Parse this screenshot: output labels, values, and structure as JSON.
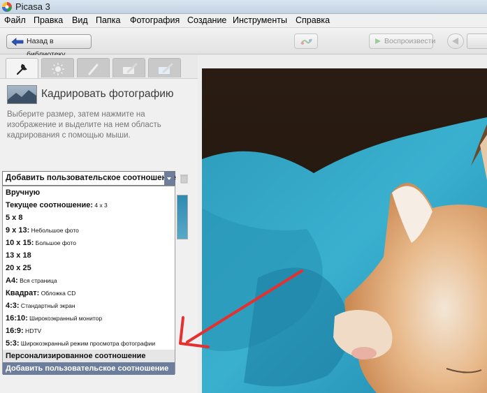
{
  "window": {
    "title": "Picasa 3"
  },
  "menu": [
    "Файл",
    "Правка",
    "Вид",
    "Папка",
    "Фотография",
    "Создание",
    "Инструменты",
    "Справка"
  ],
  "toolbar": {
    "back_label": "Назад в библиотеку",
    "play_label": "Воспроизвести"
  },
  "panel": {
    "title": "Кадрировать фотографию",
    "description": "Выберите размер, затем нажмите на изображение и выделите на нем область кадрирования с помощью мыши.",
    "selected_ratio": "Добавить пользовательское соотношение"
  },
  "ratio_options": [
    {
      "bold": "Вручную",
      "note": ""
    },
    {
      "bold": "Текущее соотношение:",
      "note": " 4 x 3"
    },
    {
      "bold": "5 x 8",
      "note": ""
    },
    {
      "bold": "9 x 13:",
      "note": " Небольшое фото"
    },
    {
      "bold": "10 x 15:",
      "note": " Большое фото"
    },
    {
      "bold": "13 x 18",
      "note": ""
    },
    {
      "bold": "20 x 25",
      "note": ""
    },
    {
      "bold": "A4:",
      "note": " Вся страница"
    },
    {
      "bold": "Квадрат:",
      "note": " Обложка CD"
    },
    {
      "bold": "4:3:",
      "note": " Стандартный экран"
    },
    {
      "bold": "16:10:",
      "note": " Широкоэкранный монитор"
    },
    {
      "bold": "16:9:",
      "note": " HDTV"
    },
    {
      "bold": "5:3:",
      "note": " Широкоэкранный режим просмотра фотографии"
    },
    {
      "bold": "Персонализированное соотношение",
      "note": ""
    },
    {
      "bold": "Добавить пользовательское соотношение",
      "note": ""
    }
  ],
  "colors": {
    "selection": "#6d7d9c",
    "annotation_arrow": "#e53030"
  },
  "icons": [
    "wrench-icon",
    "sun-icon",
    "brush-icon",
    "folder-brush-icon",
    "folder-edit-icon",
    "trash-icon",
    "back-arrow-icon",
    "play-icon"
  ]
}
